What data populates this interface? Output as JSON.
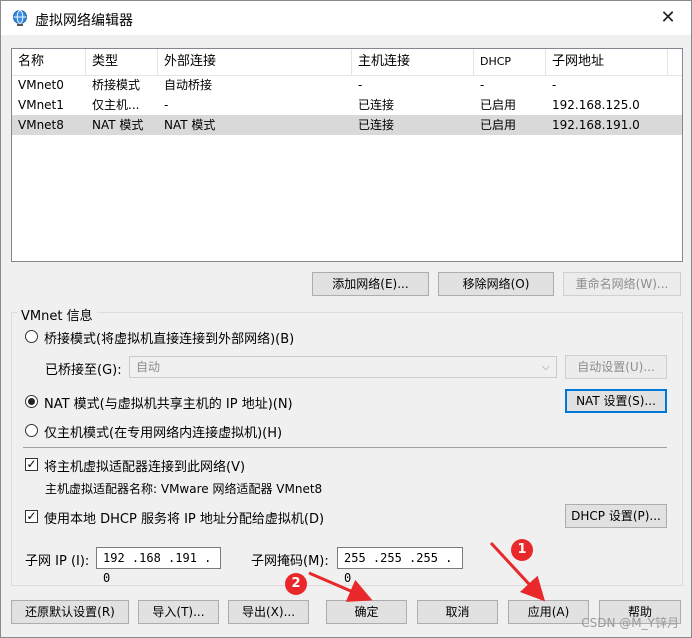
{
  "window": {
    "title": "虚拟网络编辑器",
    "close_glyph": "✕"
  },
  "network_list": {
    "columns": [
      "名称",
      "类型",
      "外部连接",
      "主机连接",
      "DHCP",
      "子网地址"
    ],
    "rows": [
      [
        "VMnet0",
        "桥接模式",
        "自动桥接",
        "-",
        "-",
        "-"
      ],
      [
        "VMnet1",
        "仅主机...",
        "-",
        "已连接",
        "已启用",
        "192.168.125.0"
      ],
      [
        "VMnet8",
        "NAT 模式",
        "NAT 模式",
        "已连接",
        "已启用",
        "192.168.191.0"
      ]
    ],
    "selected_index": 2
  },
  "list_buttons": {
    "add": "添加网络(E)...",
    "remove": "移除网络(O)",
    "rename": "重命名网络(W)..."
  },
  "vmnet_info": {
    "group_label": "VMnet 信息",
    "bridged_mode": "桥接模式(将虚拟机直接连接到外部网络)(B)",
    "bridged_to_label": "已桥接至(G):",
    "bridged_to_value": "自动",
    "auto_settings": "自动设置(U)...",
    "nat_mode": "NAT 模式(与虚拟机共享主机的 IP 地址)(N)",
    "nat_settings": "NAT 设置(S)...",
    "host_only_mode": "仅主机模式(在专用网络内连接虚拟机)(H)",
    "selected_mode": "nat",
    "connect_adapter": "将主机虚拟适配器连接到此网络(V)",
    "connect_adapter_checked": true,
    "adapter_name": "主机虚拟适配器名称: VMware 网络适配器 VMnet8",
    "use_dhcp": "使用本地 DHCP 服务将 IP 地址分配给虚拟机(D)",
    "use_dhcp_checked": true,
    "dhcp_settings": "DHCP 设置(P)...",
    "subnet_ip_label": "子网 IP (I):",
    "subnet_ip": "192 .168 .191 . 0",
    "subnet_mask_label": "子网掩码(M):",
    "subnet_mask": "255 .255 .255 . 0"
  },
  "bottom_buttons": {
    "restore": "还原默认设置(R)",
    "import": "导入(T)...",
    "export": "导出(X)...",
    "ok": "确定",
    "cancel": "取消",
    "apply": "应用(A)",
    "help": "帮助"
  },
  "annotations": {
    "badge1": "1",
    "badge2": "2",
    "arrow_color": "#e8282a"
  },
  "watermark": "CSDN @M_Y锌月"
}
